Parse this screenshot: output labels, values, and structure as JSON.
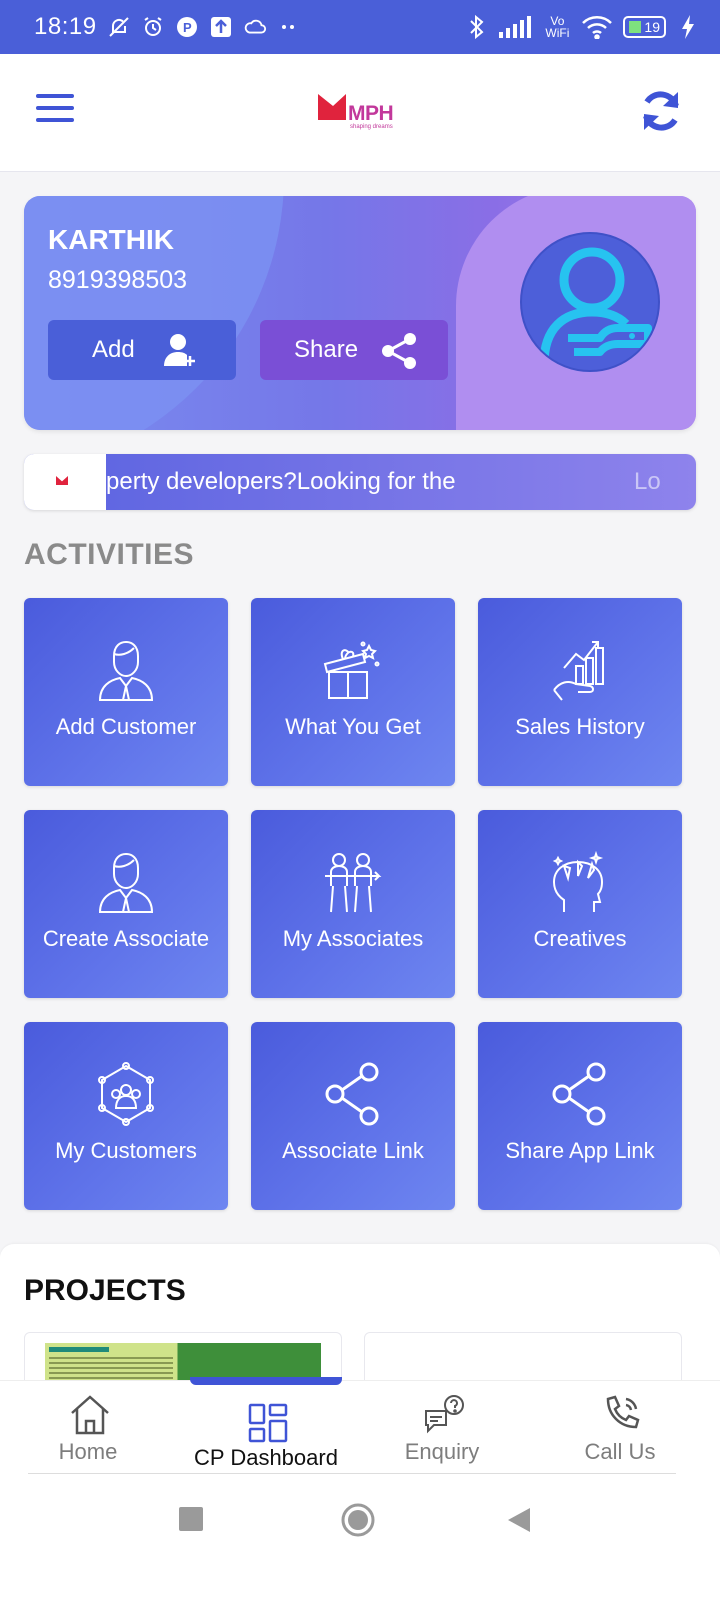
{
  "status_bar": {
    "time": "18:19",
    "battery": "19",
    "network": "Vo WiFi"
  },
  "app_bar": {
    "logo_text": "MPH",
    "logo_tagline": "shaping dreams"
  },
  "profile": {
    "name": "KARTHIK",
    "phone": "8919398503",
    "add_label": "Add",
    "share_label": "Share"
  },
  "ticker": {
    "text": "perty developers?Looking for the",
    "tail": "Lo"
  },
  "activities": {
    "title": "ACTIVITIES",
    "tiles": [
      {
        "label": "Add Customer",
        "icon": "customer-icon"
      },
      {
        "label": "What You Get",
        "icon": "gift-icon"
      },
      {
        "label": "Sales History",
        "icon": "sales-chart-icon"
      },
      {
        "label": "Create Associate",
        "icon": "associate-icon"
      },
      {
        "label": "My Associates",
        "icon": "team-icon"
      },
      {
        "label": "Creatives",
        "icon": "creative-head-icon"
      },
      {
        "label": "My Customers",
        "icon": "network-icon"
      },
      {
        "label": "Associate Link",
        "icon": "share-icon"
      },
      {
        "label": "Share App Link",
        "icon": "share-icon"
      }
    ]
  },
  "projects": {
    "title": "PROJECTS"
  },
  "bottom_nav": {
    "items": [
      {
        "label": "Home",
        "icon": "home-icon"
      },
      {
        "label": "CP Dashboard",
        "icon": "dashboard-icon",
        "active": true
      },
      {
        "label": "Enquiry",
        "icon": "enquiry-icon"
      },
      {
        "label": "Call Us",
        "icon": "phone-icon"
      }
    ]
  },
  "colors": {
    "primary": "#4a5fd8",
    "accent_purple": "#7a4fd6",
    "tile_start": "#4a5bdc",
    "tile_end": "#6e86f0"
  }
}
